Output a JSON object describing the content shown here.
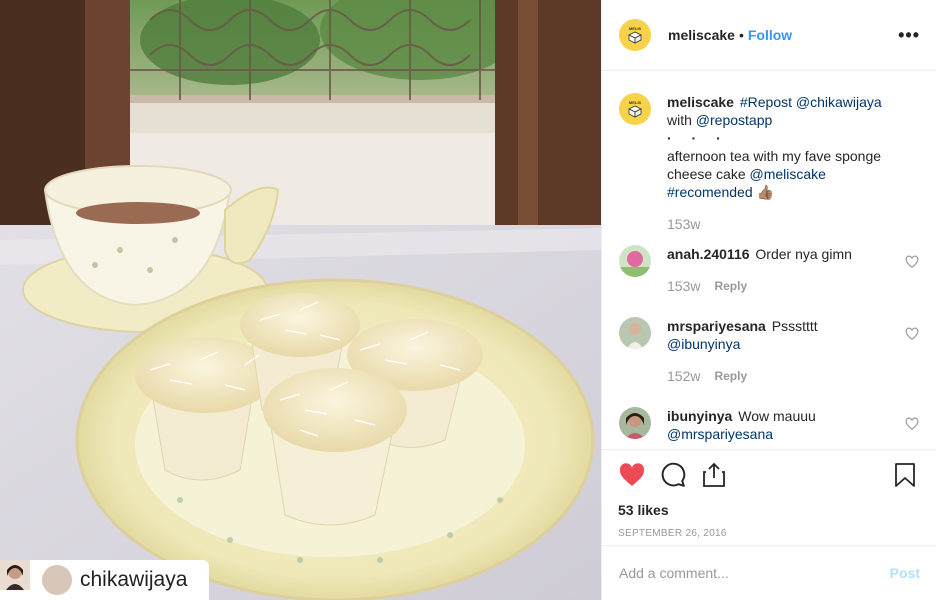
{
  "photo": {
    "repost_icon": "repost-icon",
    "credit_username": "chikawijaya"
  },
  "header": {
    "username": "meliscake",
    "separator": "•",
    "follow_label": "Follow",
    "more_icon": "more-icon",
    "more_label": "•••"
  },
  "caption": {
    "username": "meliscake",
    "tag_repost": "#Repost",
    "mention_1": "@chikawijaya",
    "text_with": "with",
    "mention_2": "@repostapp",
    "dots": "· · ·",
    "text_main": "afternoon tea with my fave sponge cheese cake",
    "mention_3": "@meliscake",
    "tag_2": "#recomended",
    "emoji": "👍🏽",
    "time": "153w"
  },
  "comments": [
    {
      "username": "anah.240116",
      "text": "Order nya gimn",
      "mention": "",
      "time": "153w",
      "reply_label": "Reply"
    },
    {
      "username": "mrspariyesana",
      "text": "Pssstttt",
      "mention": "@ibunyinya",
      "time": "152w",
      "reply_label": "Reply"
    },
    {
      "username": "ibunyinya",
      "text": "Wow mauuu",
      "mention": "@mrspariyesana",
      "time": "",
      "reply_label": ""
    }
  ],
  "actions": {
    "like_icon": "heart-filled-icon",
    "comment_icon": "comment-icon",
    "share_icon": "share-icon",
    "save_icon": "bookmark-icon",
    "likes": "53 likes",
    "date": "SEPTEMBER 26, 2016"
  },
  "add_comment": {
    "placeholder": "Add a comment...",
    "post_label": "Post"
  },
  "colors": {
    "link": "#003569",
    "follow": "#3897f0",
    "like": "#ed4956",
    "post_disabled": "#b2dffc",
    "muted": "#999999"
  }
}
